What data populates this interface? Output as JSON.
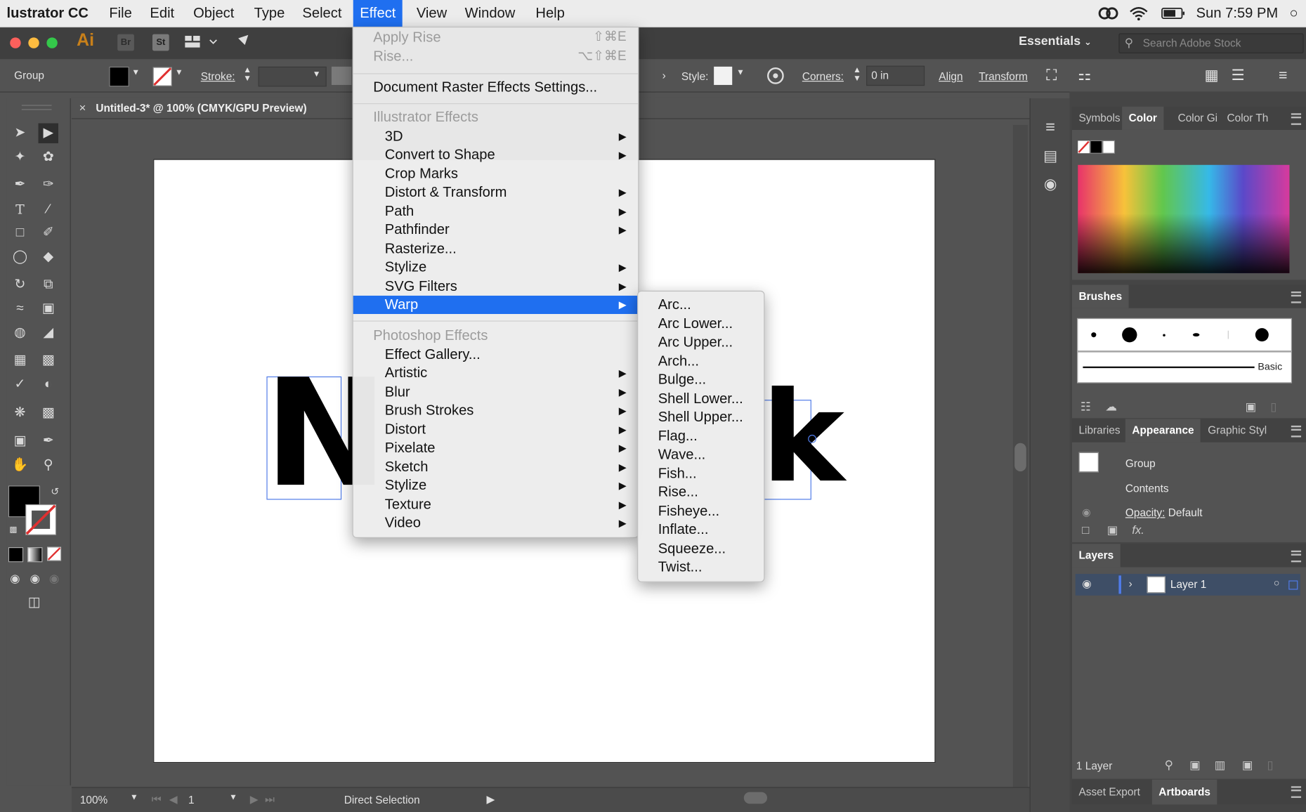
{
  "menubar": {
    "app": "lustrator CC",
    "items": [
      "File",
      "Edit",
      "Object",
      "Type",
      "Select",
      "Effect",
      "View",
      "Window",
      "Help"
    ],
    "clock": "Sun 7:59 PM"
  },
  "appbar": {
    "ai_logo": "Ai",
    "br": "Br",
    "st": "St",
    "workspace": "Essentials",
    "search_placeholder": "Search Adobe Stock"
  },
  "controlbar": {
    "selection": "Group",
    "stroke_label": "Stroke:",
    "style_label": "Style:",
    "corners_label": "Corners:",
    "corners_value": "0 in",
    "align": "Align",
    "transform": "Transform"
  },
  "document": {
    "tab_title": "Untitled-3* @ 100% (CMYK/GPU Preview)",
    "art_left": "N",
    "art_right": "k"
  },
  "effect_menu": {
    "apply": "Apply Rise",
    "apply_sc": "⇧⌘E",
    "last": "Rise...",
    "last_sc": "⌥⇧⌘E",
    "docraster": "Document Raster Effects Settings...",
    "ill_header": "Illustrator Effects",
    "ill_items": [
      "3D",
      "Convert to Shape",
      "Crop Marks",
      "Distort & Transform",
      "Path",
      "Pathfinder",
      "Rasterize...",
      "Stylize",
      "SVG Filters",
      "Warp"
    ],
    "ps_header": "Photoshop Effects",
    "ps_items": [
      "Effect Gallery...",
      "Artistic",
      "Blur",
      "Brush Strokes",
      "Distort",
      "Pixelate",
      "Sketch",
      "Stylize",
      "Texture",
      "Video"
    ]
  },
  "warp_menu": {
    "items": [
      "Arc...",
      "Arc Lower...",
      "Arc Upper...",
      "Arch...",
      "Bulge...",
      "Shell Lower...",
      "Shell Upper...",
      "Flag...",
      "Wave...",
      "Fish...",
      "Rise...",
      "Fisheye...",
      "Inflate...",
      "Squeeze...",
      "Twist..."
    ]
  },
  "panels": {
    "color_tabs": [
      "Symbols",
      "Color",
      "Color Gi",
      "Color Th"
    ],
    "brushes_title": "Brushes",
    "brush_basic": "Basic",
    "appearance_tabs": [
      "Libraries",
      "Appearance",
      "Graphic Styl"
    ],
    "appearance_group": "Group",
    "appearance_contents": "Contents",
    "opacity_label": "Opacity:",
    "opacity_value": "Default",
    "fx_label": "fx.",
    "layers_title": "Layers",
    "layer_name": "Layer 1",
    "layer_count": "1 Layer",
    "bottom_tabs": [
      "Asset Export",
      "Artboards"
    ]
  },
  "statusbar": {
    "zoom": "100%",
    "artboard_num": "1",
    "tool": "Direct Selection"
  },
  "colors": {
    "menu_highlight": "#1f6ff0",
    "panel_bg": "#535353",
    "desktop": "#ddb638"
  }
}
